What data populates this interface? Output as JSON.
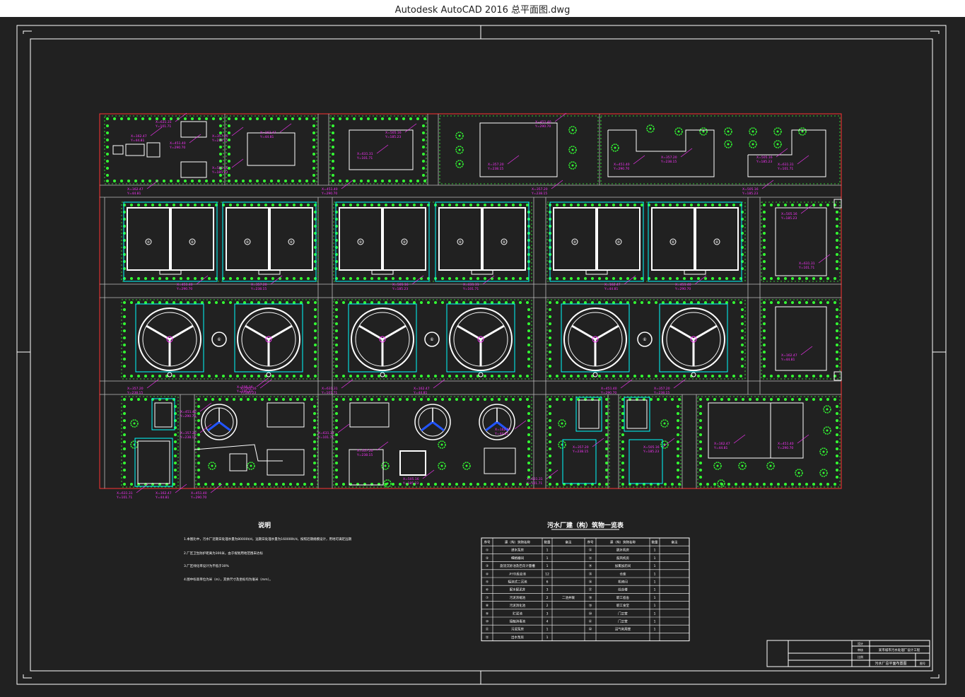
{
  "window": {
    "title": "Autodesk AutoCAD 2016     总平面图.dwg"
  },
  "colors": {
    "background": "#212121",
    "frame": "#ffffff",
    "site_boundary": "#ff3333",
    "trees": "#33ff33",
    "labels": "#ff33ff",
    "tanks": "#00ffff"
  },
  "notes": {
    "title": "说明",
    "lines": [
      "1.本图比中，污水厂近期日处理水量为80000t/d，远期日处理水量为160000t/d，按照近期规模设计，用地可满足远期",
      "2.厂区卫生防护距离为300米，由于规划用地范围未达标",
      "3.厂区绿化率设计为不低于30%",
      "4.图中标高单位为米（m），其余尺寸及坐标均为毫米（mm）。"
    ]
  },
  "table": {
    "title": "污水厂建（构）筑物一览表",
    "headers": [
      "序号",
      "建（构）筑物名称",
      "数量",
      "备注",
      "序号",
      "建（构）筑物名称",
      "数量",
      "备注"
    ],
    "rows": [
      [
        "①",
        "进水泵房",
        "1",
        "",
        "⑫",
        "脱水机房",
        "1",
        ""
      ],
      [
        "②",
        "细格栅间",
        "1",
        "",
        "⑬",
        "鼓风机房",
        "1",
        ""
      ],
      [
        "③",
        "旋流沉砂池及巴氏计量槽",
        "1",
        "",
        "⑭",
        "加氯加药间",
        "1",
        ""
      ],
      [
        "④",
        "A²/O反应池",
        "12",
        "",
        "⑮",
        "仓库",
        "1",
        ""
      ],
      [
        "⑤",
        "辐流式二沉池",
        "6",
        "",
        "⑯",
        "机修间",
        "1",
        ""
      ],
      [
        "⑥",
        "配水配泥井",
        "3",
        "",
        "⑰",
        "综合楼",
        "1",
        ""
      ],
      [
        "⑦",
        "污泥浓缩池",
        "2",
        "二池并联",
        "⑱",
        "职工宿舍",
        "1",
        ""
      ],
      [
        "⑧",
        "污泥消化池",
        "2",
        "",
        "⑲",
        "职工食堂",
        "1",
        ""
      ],
      [
        "⑨",
        "贮泥池",
        "3",
        "",
        "⑳",
        "门卫室",
        "1",
        ""
      ],
      [
        "⑩",
        "接触消毒池",
        "4",
        "",
        "㉑",
        "门卫室",
        "1",
        ""
      ],
      [
        "⑪",
        "污泥泵房",
        "1",
        "",
        "㉒",
        "沼气利用室",
        "1",
        ""
      ],
      [
        "⑫",
        "出水泵房",
        "1",
        "",
        "",
        "",
        "",
        ""
      ]
    ]
  },
  "title_block": {
    "project": "某市城市污水处理厂设计工程",
    "drawing": "污水厂总平面布置图",
    "label_a": "设计",
    "label_b": "审核",
    "label_c": "比例",
    "label_d": "图号"
  },
  "site": {
    "tank_number_a2o": "④",
    "tank_number_clarifier": "⑤",
    "tank_number_well": "⑥",
    "coords": [
      "X=451.40",
      "Y=290.70",
      "X=357.20",
      "Y=238.15",
      "X=505.16",
      "Y=185.23",
      "X=631.31",
      "Y=101.71",
      "X=162.47",
      "Y=44.81"
    ]
  }
}
